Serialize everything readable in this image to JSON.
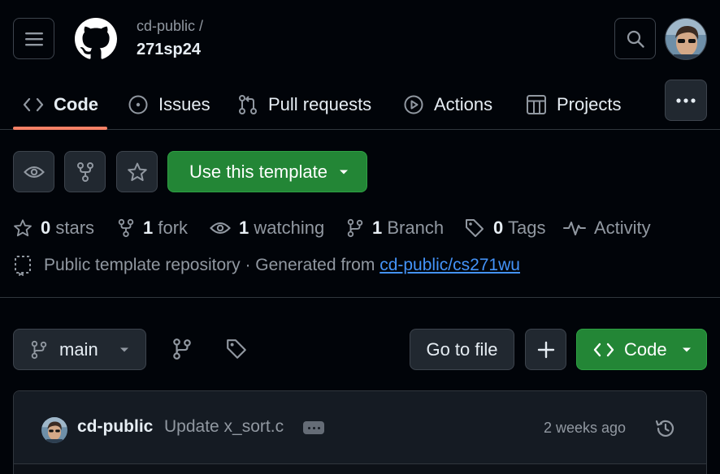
{
  "header": {
    "owner": "cd-public /",
    "repo": "271sp24"
  },
  "nav": {
    "tabs": [
      {
        "label": "Code",
        "icon": "code-icon",
        "active": true
      },
      {
        "label": "Issues",
        "icon": "issue-icon"
      },
      {
        "label": "Pull requests",
        "icon": "pull-request-icon"
      },
      {
        "label": "Actions",
        "icon": "play-icon"
      },
      {
        "label": "Projects",
        "icon": "table-icon"
      }
    ]
  },
  "repo_actions": {
    "template_button": "Use this template"
  },
  "stats": {
    "stars_count": "0",
    "stars_label": "stars",
    "forks_count": "1",
    "forks_label": "fork",
    "watching_count": "1",
    "watching_label": "watching",
    "branch_count": "1",
    "branch_label": "Branch",
    "tags_count": "0",
    "tags_label": "Tags",
    "activity_label": "Activity"
  },
  "template_info": {
    "text": "Public template repository · Generated from",
    "link": "cd-public/cs271wu"
  },
  "toolbar": {
    "branch": "main",
    "goto_file": "Go to file",
    "code_button": "Code"
  },
  "commit": {
    "author": "cd-public",
    "message": "Update x_sort.c",
    "time": "2 weeks ago"
  },
  "colors": {
    "background": "#010409",
    "accent_green": "#238636",
    "link_blue": "#4493f8",
    "tab_underline": "#f78166"
  }
}
